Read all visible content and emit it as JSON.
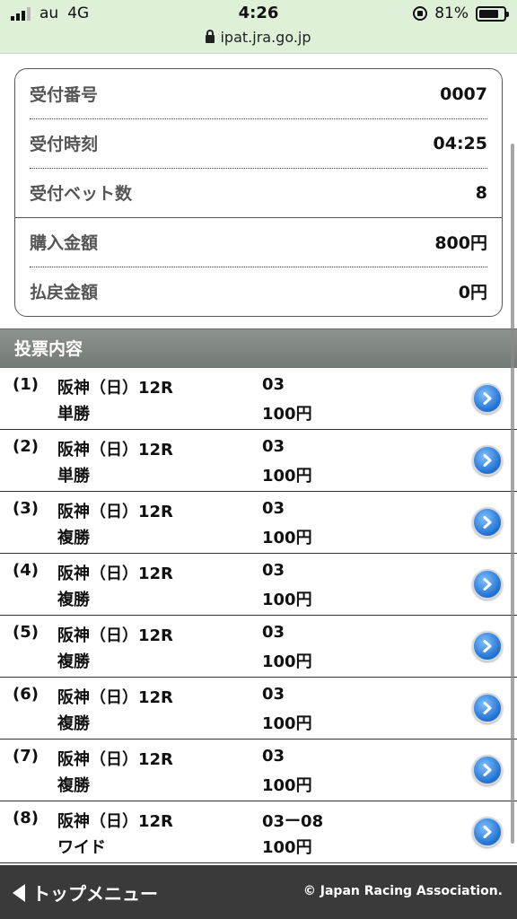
{
  "status_bar": {
    "carrier": "au",
    "network": "4G",
    "time": "4:26",
    "battery": "81%",
    "battery_level": 0.81,
    "url": "ipat.jra.go.jp"
  },
  "summary": {
    "rows": [
      {
        "label": "受付番号",
        "value": "0007"
      },
      {
        "label": "受付時刻",
        "value": "04:25"
      },
      {
        "label": "受付ベット数",
        "value": "8"
      },
      {
        "label": "購入金額",
        "value": "800円"
      },
      {
        "label": "払戻金額",
        "value": "0円"
      }
    ]
  },
  "section_title": "投票内容",
  "bets": [
    {
      "num": "(1)",
      "race": "阪神（日）12R",
      "type": "単勝",
      "horses": "03",
      "amount": "100円"
    },
    {
      "num": "(2)",
      "race": "阪神（日）12R",
      "type": "単勝",
      "horses": "03",
      "amount": "100円"
    },
    {
      "num": "(3)",
      "race": "阪神（日）12R",
      "type": "複勝",
      "horses": "03",
      "amount": "100円"
    },
    {
      "num": "(4)",
      "race": "阪神（日）12R",
      "type": "複勝",
      "horses": "03",
      "amount": "100円"
    },
    {
      "num": "(5)",
      "race": "阪神（日）12R",
      "type": "複勝",
      "horses": "03",
      "amount": "100円"
    },
    {
      "num": "(6)",
      "race": "阪神（日）12R",
      "type": "複勝",
      "horses": "03",
      "amount": "100円"
    },
    {
      "num": "(7)",
      "race": "阪神（日）12R",
      "type": "複勝",
      "horses": "03",
      "amount": "100円"
    },
    {
      "num": "(8)",
      "race": "阪神（日）12R",
      "type": "ワイド",
      "horses": "03ー08",
      "amount": "100円"
    }
  ],
  "footer": {
    "top_menu": "トップメニュー",
    "copyright": "© Japan Racing Association."
  },
  "colors": {
    "status_bar_bg": "#dff0d8",
    "section_header_bg": "#7d847d",
    "footer_bg": "#3a3a3a",
    "arrow_button": "#2b7de0"
  },
  "icons": {
    "arrow": "chevron-right-circle-icon",
    "back": "triangle-left-icon",
    "lock": "lock-icon"
  }
}
